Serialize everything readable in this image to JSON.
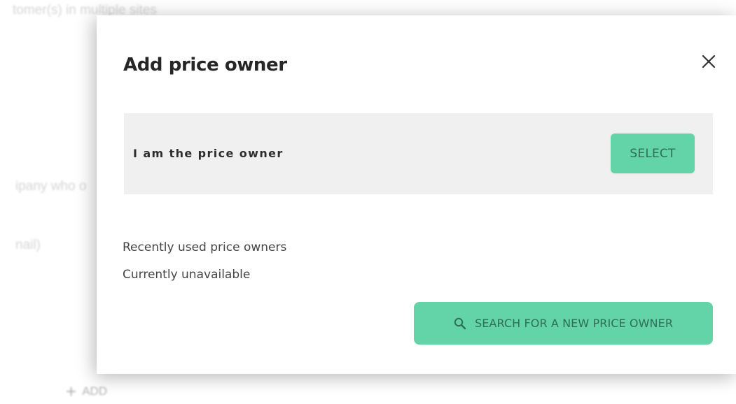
{
  "background": {
    "top_text": "tomer(s) in multiple sites",
    "middle_text": "ipany who o",
    "lower_text": "nail)",
    "add_label": "ADD"
  },
  "modal": {
    "title": "Add price owner",
    "close_icon": "close-icon",
    "self_option": {
      "label": "I am the price owner",
      "select_label": "SELECT"
    },
    "recent": {
      "title": "Recently used price owners",
      "status": "Currently unavailable"
    },
    "search_button": {
      "icon": "search-icon",
      "label": "SEARCH FOR A NEW PRICE OWNER"
    }
  },
  "colors": {
    "accent": "#63d3a8",
    "accent_text": "#2e6f58",
    "row_background": "#f0f0f0",
    "title_text": "#262626"
  }
}
